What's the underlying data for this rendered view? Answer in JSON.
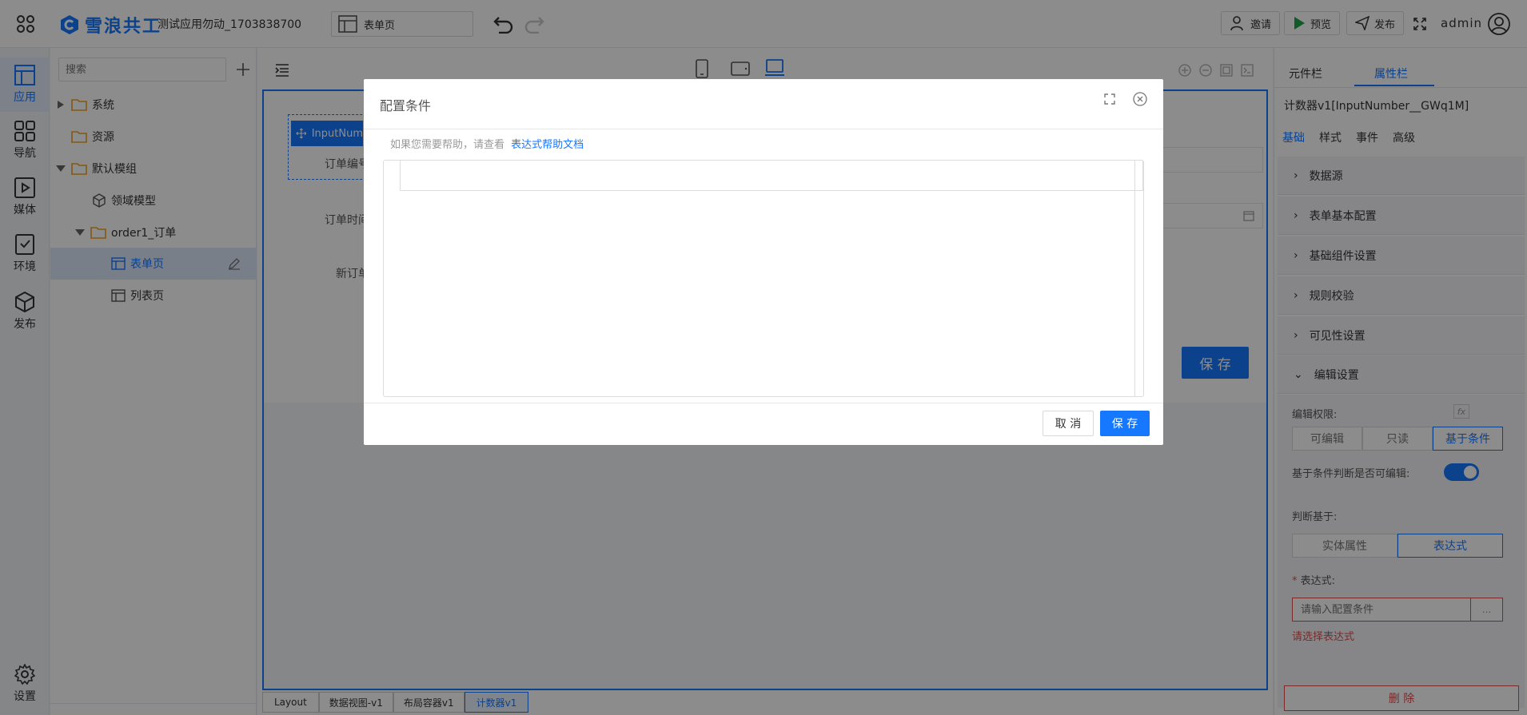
{
  "topbar": {
    "logo_text": "雪浪共工",
    "app_name": "测试应用勿动_1703838700",
    "page_tab": "表单页",
    "invite": "邀请",
    "preview": "预览",
    "publish": "发布",
    "user": "admin"
  },
  "rail": {
    "items": [
      "应用",
      "导航",
      "媒体",
      "环境",
      "发布"
    ],
    "settings": "设置"
  },
  "tree": {
    "search_placeholder": "搜索",
    "nodes": [
      "系统",
      "资源",
      "默认模组",
      "领域模型",
      "order1_订单",
      "表单页",
      "列表页"
    ]
  },
  "canvas": {
    "selected_component": "InputNum",
    "labels": [
      "订单编号",
      "订单时间",
      "新订单"
    ],
    "save_button": "保 存"
  },
  "breadcrumb": [
    "Layout",
    "数据视图-v1",
    "布局容器v1",
    "计数器v1"
  ],
  "right_panel": {
    "tabs": [
      "元件栏",
      "属性栏"
    ],
    "component_title": "计数器v1[InputNumber__GWq1M]",
    "subtabs": [
      "基础",
      "样式",
      "事件",
      "高级"
    ],
    "sections": [
      "数据源",
      "表单基本配置",
      "基础组件设置",
      "规则校验",
      "可见性设置",
      "编辑设置"
    ],
    "edit_permission_label": "编辑权限:",
    "edit_permission_options": [
      "可编辑",
      "只读",
      "基于条件"
    ],
    "toggle_label": "基于条件判断是否可编辑:",
    "judge_label": "判断基于:",
    "judge_options": [
      "实体属性",
      "表达式"
    ],
    "expr_label": "表达式:",
    "expr_placeholder": "请输入配置条件",
    "expr_button": "...",
    "expr_error": "请选择表达式",
    "delete_button": "删 除"
  },
  "modal": {
    "title": "配置条件",
    "help_prefix": "如果您需要帮助，请查看",
    "help_link": "表达式帮助文档",
    "cancel": "取 消",
    "save": "保 存"
  },
  "colors": {
    "primary": "#1677ff",
    "danger": "#e24c4c"
  }
}
